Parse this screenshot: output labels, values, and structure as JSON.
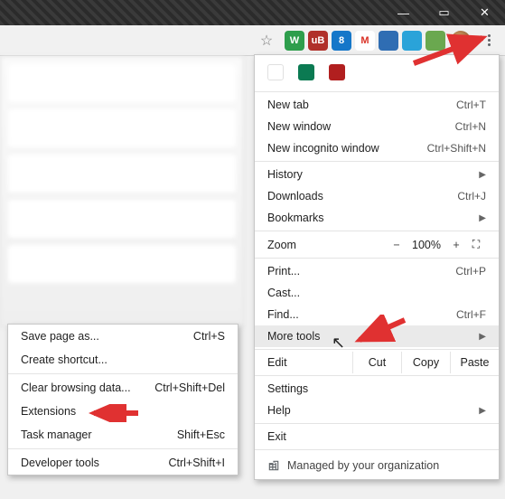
{
  "window_controls": {
    "min": "—",
    "max": "▭",
    "close": "✕"
  },
  "toolbar": {
    "star": "☆",
    "extensions": [
      {
        "name": "ext-w",
        "bg": "#2e9e4c",
        "label": "W"
      },
      {
        "name": "ext-ublock",
        "bg": "#b0302a",
        "label": "uB"
      },
      {
        "name": "ext-sec",
        "bg": "#1577c9",
        "label": "8"
      },
      {
        "name": "ext-gmail",
        "bg": "#ffffff",
        "label": "M",
        "fg": "#d93025"
      },
      {
        "name": "ext-office",
        "bg": "#2f6db3",
        "label": ""
      },
      {
        "name": "ext-cloud",
        "bg": "#2aa3d9",
        "label": ""
      },
      {
        "name": "ext-dots",
        "bg": "#6aa84f",
        "label": ""
      }
    ]
  },
  "menu": {
    "apps": [
      {
        "name": "app-google",
        "bg": "#fff",
        "border": "#e0e0e0"
      },
      {
        "name": "app-green",
        "bg": "#0b7a52"
      },
      {
        "name": "app-pdf",
        "bg": "#b11f1f"
      }
    ],
    "new_tab": {
      "label": "New tab",
      "shortcut": "Ctrl+T"
    },
    "new_window": {
      "label": "New window",
      "shortcut": "Ctrl+N"
    },
    "new_incognito": {
      "label": "New incognito window",
      "shortcut": "Ctrl+Shift+N"
    },
    "history": {
      "label": "History"
    },
    "downloads": {
      "label": "Downloads",
      "shortcut": "Ctrl+J"
    },
    "bookmarks": {
      "label": "Bookmarks"
    },
    "zoom": {
      "label": "Zoom",
      "minus": "−",
      "pct": "100%",
      "plus": "+",
      "full": "⛶"
    },
    "print": {
      "label": "Print...",
      "shortcut": "Ctrl+P"
    },
    "cast": {
      "label": "Cast..."
    },
    "find": {
      "label": "Find...",
      "shortcut": "Ctrl+F"
    },
    "more_tools": {
      "label": "More tools"
    },
    "edit": {
      "label": "Edit",
      "cut": "Cut",
      "copy": "Copy",
      "paste": "Paste"
    },
    "settings": {
      "label": "Settings"
    },
    "help": {
      "label": "Help"
    },
    "exit": {
      "label": "Exit"
    },
    "managed": {
      "label": "Managed by your organization"
    }
  },
  "submenu": {
    "save_page": {
      "label": "Save page as...",
      "shortcut": "Ctrl+S"
    },
    "create_shortcut": {
      "label": "Create shortcut..."
    },
    "clear_data": {
      "label": "Clear browsing data...",
      "shortcut": "Ctrl+Shift+Del"
    },
    "extensions": {
      "label": "Extensions"
    },
    "task_manager": {
      "label": "Task manager",
      "shortcut": "Shift+Esc"
    },
    "dev_tools": {
      "label": "Developer tools",
      "shortcut": "Ctrl+Shift+I"
    }
  }
}
